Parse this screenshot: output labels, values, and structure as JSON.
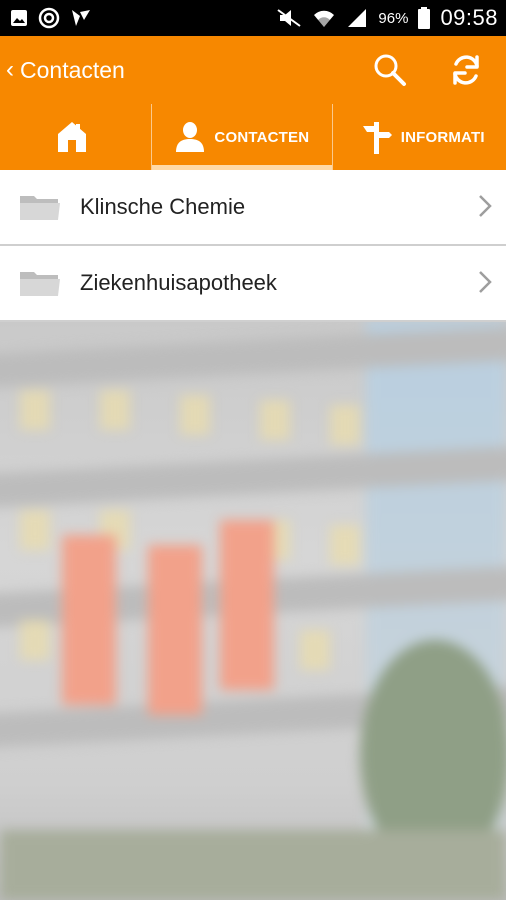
{
  "status_bar": {
    "battery_percent": "96%",
    "time": "09:58",
    "icons": [
      "gallery-icon",
      "sync-icon",
      "flipboard-icon",
      "mute-icon",
      "wifi-icon",
      "signal-icon",
      "battery-icon"
    ]
  },
  "app_bar": {
    "title": "Contacten",
    "actions": [
      "search-icon",
      "refresh-icon"
    ]
  },
  "tabs": [
    {
      "label": "",
      "icon": "home-icon",
      "selected": false
    },
    {
      "label": "CONTACTEN",
      "icon": "person-icon",
      "selected": true
    },
    {
      "label": "INFORMATI",
      "icon": "signpost-icon",
      "selected": false
    }
  ],
  "list": {
    "items": [
      {
        "label": "Klinsche Chemie",
        "icon": "folder-icon"
      },
      {
        "label": "Ziekenhuisapotheek",
        "icon": "folder-icon"
      }
    ]
  },
  "colors": {
    "accent": "#f78800",
    "tab_indicator": "#ffd9a6",
    "list_text": "#222222"
  }
}
